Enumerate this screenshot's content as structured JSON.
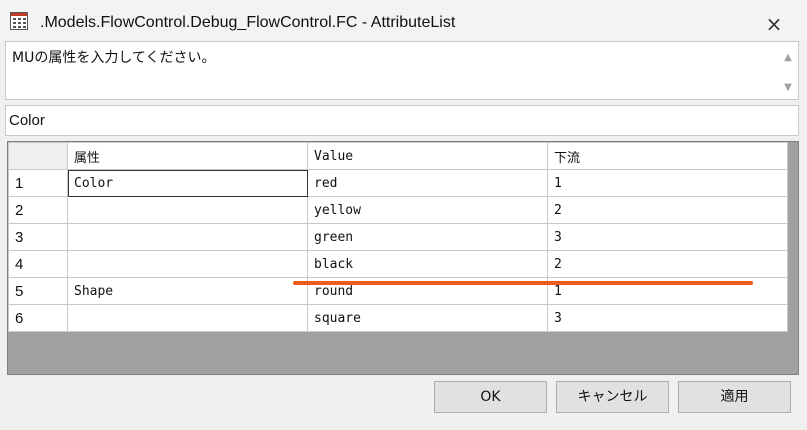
{
  "window": {
    "title": ".Models.FlowControl.Debug_FlowControl.FC - AttributeList",
    "close_label": "×"
  },
  "description": {
    "text": "MUの属性を入力してください。"
  },
  "attribute_field": {
    "value": "Color"
  },
  "table": {
    "headers": [
      "属性",
      "Value",
      "下流"
    ],
    "rows": [
      {
        "index": "1",
        "attr": "Color",
        "value": "red",
        "downstream": "1"
      },
      {
        "index": "2",
        "attr": "",
        "value": "yellow",
        "downstream": "2"
      },
      {
        "index": "3",
        "attr": "",
        "value": "green",
        "downstream": "3"
      },
      {
        "index": "4",
        "attr": "",
        "value": "black",
        "downstream": "2"
      },
      {
        "index": "5",
        "attr": "Shape",
        "value": "round",
        "downstream": "1"
      },
      {
        "index": "6",
        "attr": "",
        "value": "square",
        "downstream": "3"
      }
    ]
  },
  "buttons": {
    "ok": "OK",
    "cancel": "キャンセル",
    "apply": "適用"
  },
  "colors": {
    "annotation_underline": "#f05a1a",
    "grid_background": "#a0a0a0"
  }
}
